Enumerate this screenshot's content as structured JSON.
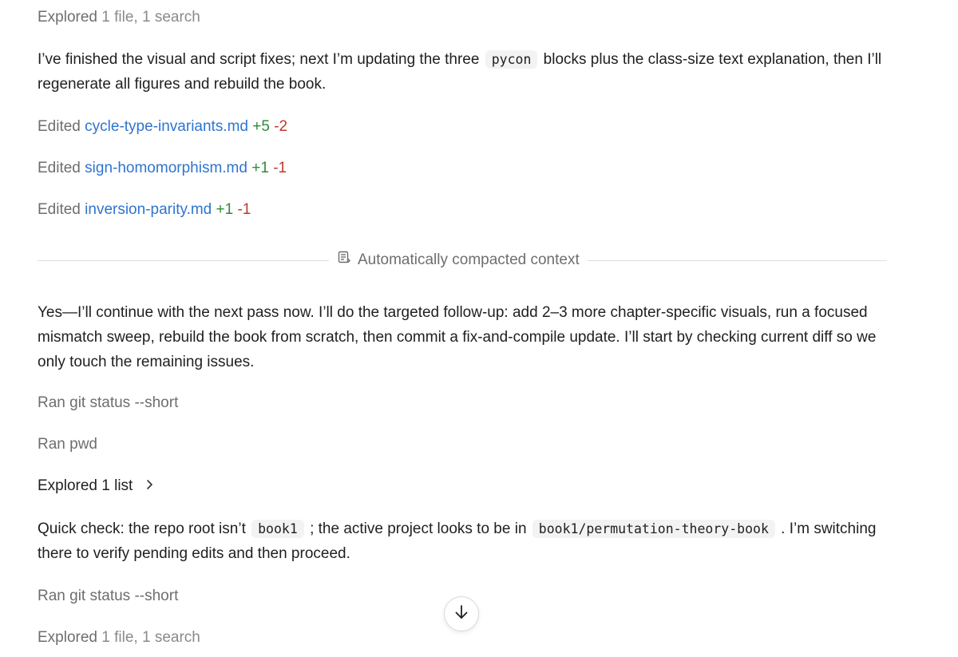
{
  "log": {
    "explored_top": {
      "verb": "Explored",
      "detail": "1 file, 1 search"
    },
    "para1": {
      "before": "I’ve finished the visual and script fixes; next I’m updating the three",
      "code": "pycon",
      "after": "blocks plus the class-size text explanation, then I’ll regenerate all figures and rebuild the book."
    },
    "edits": [
      {
        "verb": "Edited",
        "file": "cycle-type-invariants.md",
        "added": "+5",
        "removed": "-2"
      },
      {
        "verb": "Edited",
        "file": "sign-homomorphism.md",
        "added": "+1",
        "removed": "-1"
      },
      {
        "verb": "Edited",
        "file": "inversion-parity.md",
        "added": "+1",
        "removed": "-1"
      }
    ],
    "divider": {
      "label": "Automatically compacted context",
      "icon": "compact-context-icon"
    },
    "para2": "Yes—I’ll continue with the next pass now. I’ll do the targeted follow-up: add 2–3 more chapter-specific visuals, run a focused mismatch sweep, rebuild the book from scratch, then commit a fix-and-compile update. I’ll start by checking current diff so we only touch the remaining issues.",
    "ran1": "Ran git status --short",
    "ran2": "Ran pwd",
    "explored_list": {
      "text": "Explored 1 list",
      "icon": "chevron-right-icon"
    },
    "para3": {
      "before": "Quick check: the repo root isn’t",
      "code1": "book1",
      "middle": "; the active project looks to be in",
      "code2": "book1/permutation-theory-book",
      "after": ". I’m switching there to verify pending edits and then proceed."
    },
    "ran3": "Ran git status --short",
    "explored_bottom": {
      "verb": "Explored",
      "detail": "1 file, 1 search"
    },
    "scroll_button": {
      "icon": "arrow-down-icon"
    }
  },
  "colors": {
    "link": "#2f74d0",
    "added": "#2f8a3a",
    "removed": "#c0392b",
    "muted": "#6e6e6e"
  }
}
